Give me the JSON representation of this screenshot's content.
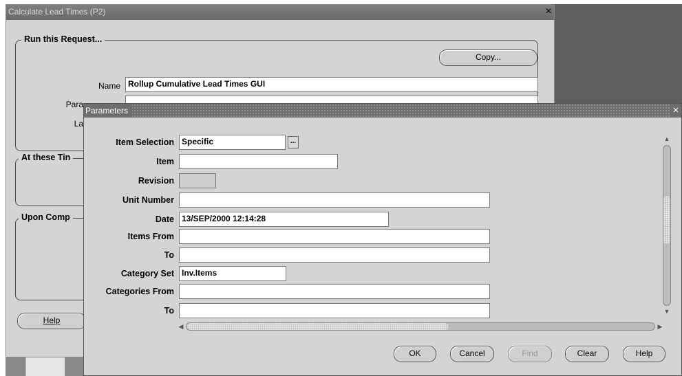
{
  "back_window": {
    "title": "Calculate Lead Times (P2)",
    "close_glyph": "×",
    "groups": {
      "run": "Run this Request...",
      "times": "At these Tin",
      "completion": "Upon Comp"
    },
    "copy_button": "Copy...",
    "name_label": "Name",
    "name_value": "Rollup Cumulative Lead Times GUI",
    "params_label": "Para",
    "language_label": "La",
    "help_button": "Help"
  },
  "parameters": {
    "title": "Parameters",
    "close_glyph": "×",
    "lov_glyph": "...",
    "fields": {
      "item_selection": {
        "label": "Item Selection",
        "value": "Specific"
      },
      "item": {
        "label": "Item",
        "value": ""
      },
      "revision": {
        "label": "Revision",
        "value": ""
      },
      "unit_number": {
        "label": "Unit Number",
        "value": ""
      },
      "date": {
        "label": "Date",
        "value": "13/SEP/2000 12:14:28"
      },
      "items_from": {
        "label": "Items From",
        "value": ""
      },
      "items_to": {
        "label": "To",
        "value": ""
      },
      "category_set": {
        "label": "Category Set",
        "value": "Inv.Items"
      },
      "categories_from": {
        "label": "Categories From",
        "value": ""
      },
      "categories_to": {
        "label": "To",
        "value": ""
      }
    },
    "buttons": {
      "ok": "OK",
      "cancel": "Cancel",
      "find": "Find",
      "clear": "Clear",
      "help": "Help"
    },
    "scroll_arrows": {
      "up": "▲",
      "down": "▼",
      "left": "◀",
      "right": "▶"
    }
  },
  "colors": {
    "window_bg": "#d4d4d4",
    "title_bar": "#6e6e6e",
    "desktop": "#5f5f5f"
  }
}
